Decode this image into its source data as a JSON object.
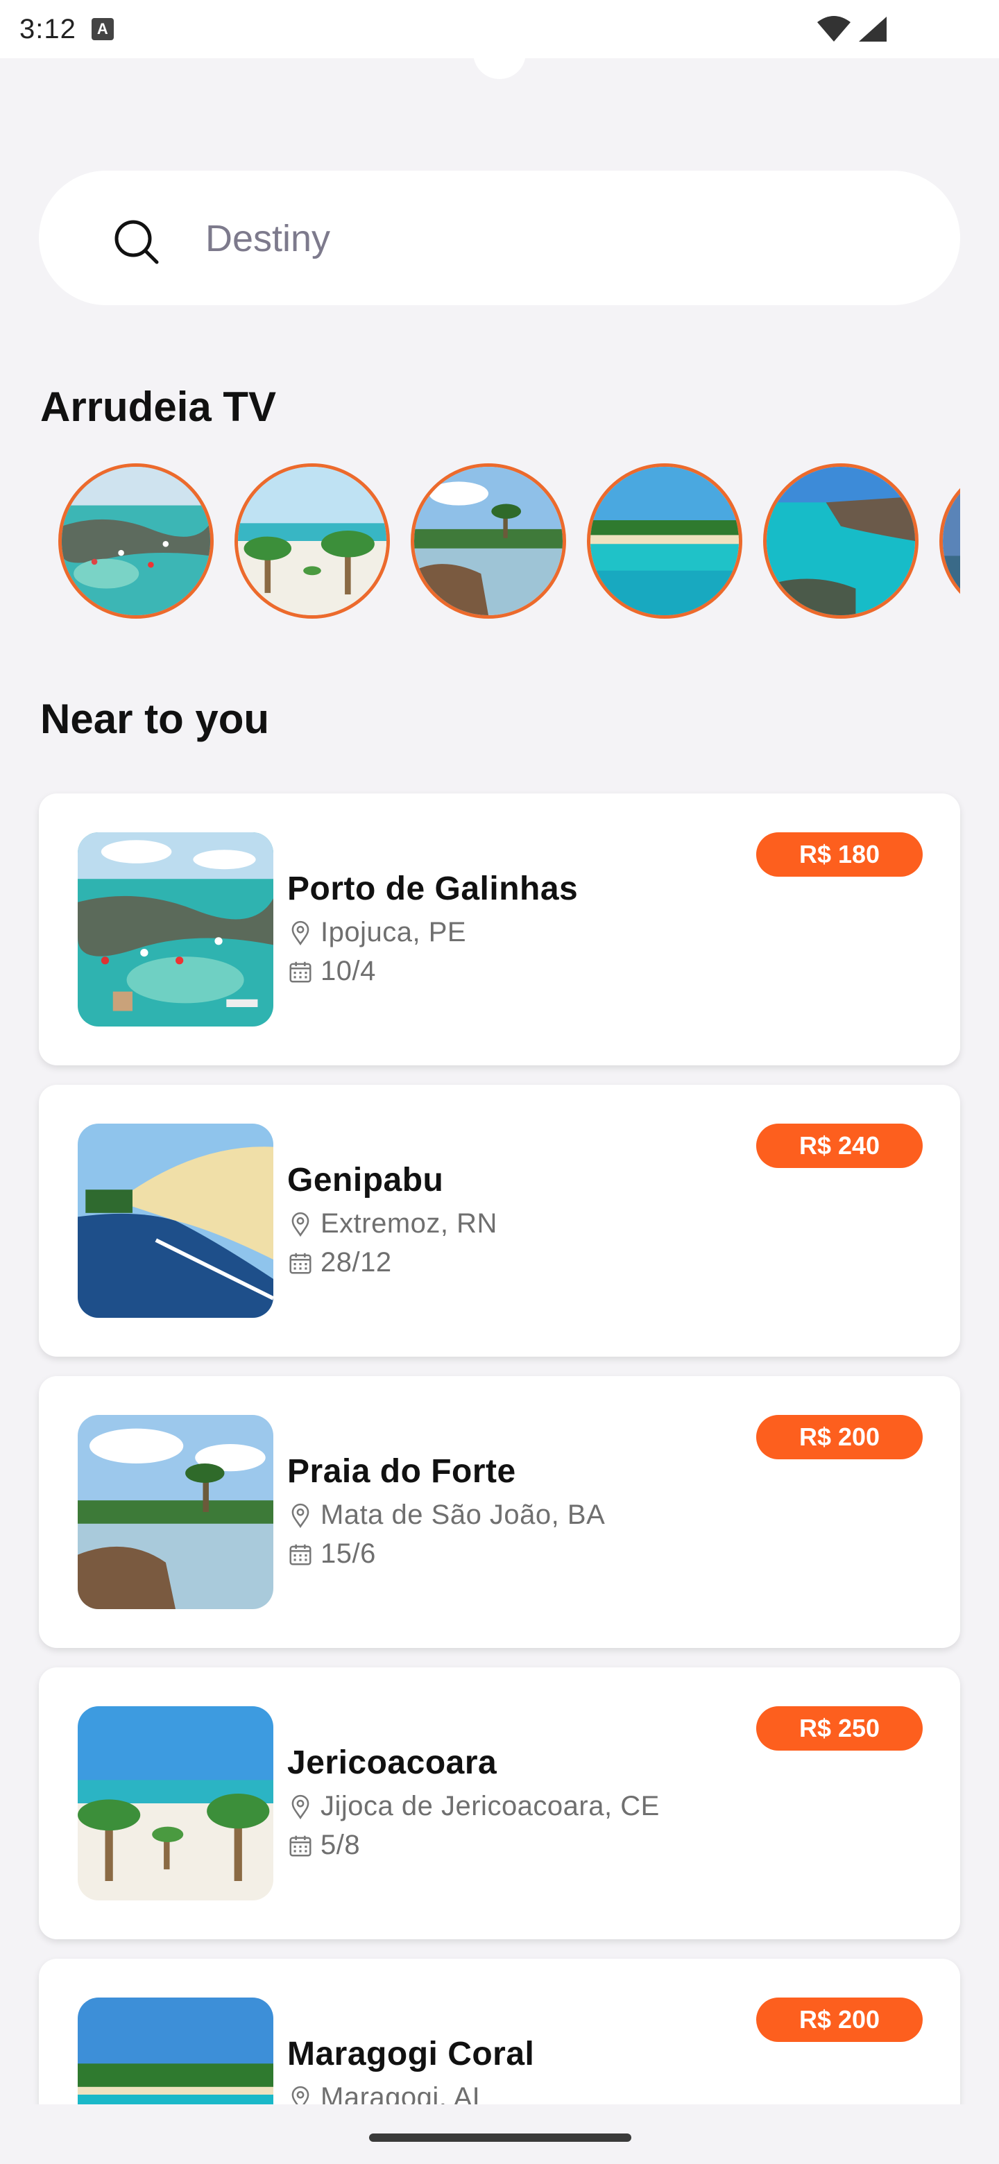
{
  "status_bar": {
    "time": "3:12",
    "notification_icon": "a-icon",
    "wifi_icon": "wifi-icon",
    "signal_icon": "signal-icon"
  },
  "search": {
    "placeholder": "Destiny",
    "icon": "search-icon"
  },
  "stories_section": {
    "title": "Arrudeia TV",
    "items": [
      {
        "name": "story-1",
        "scene": "reef"
      },
      {
        "name": "story-2",
        "scene": "palms"
      },
      {
        "name": "story-3",
        "scene": "lagoon"
      },
      {
        "name": "story-4",
        "scene": "beach"
      },
      {
        "name": "story-5",
        "scene": "pool"
      },
      {
        "name": "story-6",
        "scene": "reef"
      }
    ]
  },
  "near_section": {
    "title": "Near to you",
    "items": [
      {
        "name": "Porto de Galinhas",
        "location": "Ipojuca, PE",
        "date": "10/4",
        "price": "R$ 180",
        "scene": "reef"
      },
      {
        "name": "Genipabu",
        "location": "Extremoz, RN",
        "date": "28/12",
        "price": "R$ 240",
        "scene": "dunes"
      },
      {
        "name": "Praia do Forte",
        "location": "Mata de São João, BA",
        "date": "15/6",
        "price": "R$ 200",
        "scene": "lagoon"
      },
      {
        "name": "Jericoacoara",
        "location": "Jijoca de Jericoacoara, CE",
        "date": "5/8",
        "price": "R$ 250",
        "scene": "palms"
      },
      {
        "name": "Maragogi Coral",
        "location": "Maragogi, AL",
        "date": "",
        "price": "R$ 200",
        "scene": "beach"
      }
    ]
  },
  "colors": {
    "accent": "#fd5f1e",
    "story_ring": "#ec6a2c",
    "background": "#f4f3f6"
  }
}
